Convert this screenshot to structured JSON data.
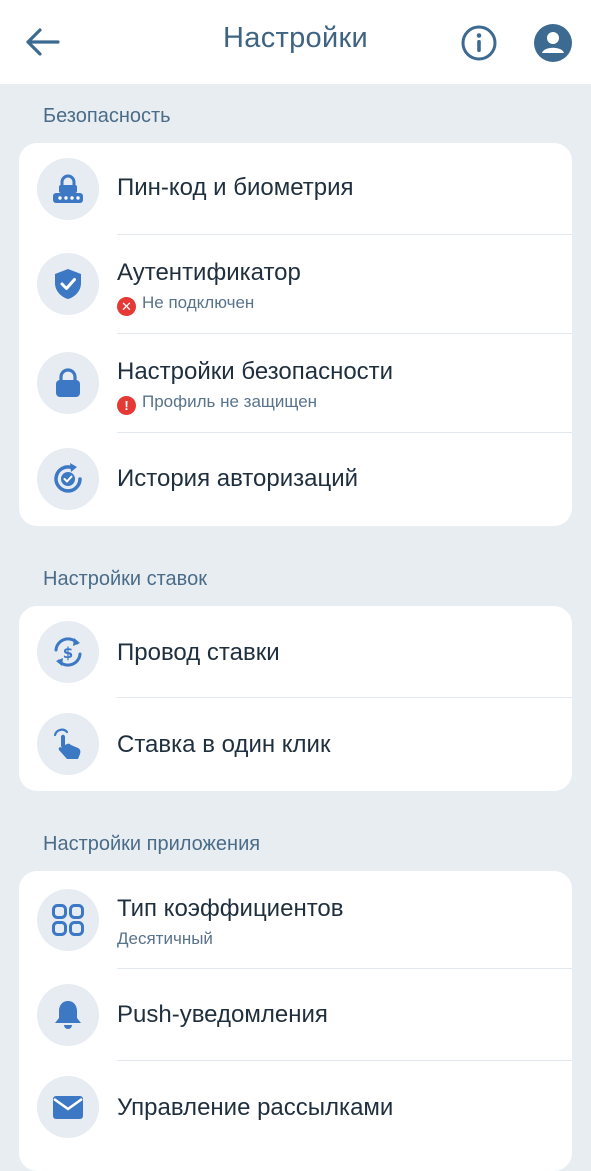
{
  "header": {
    "title": "Настройки"
  },
  "colors": {
    "accent": "#3d78c4",
    "icon_bg": "#e6ecf2",
    "error": "#e53935",
    "page_bg": "#e8edf2"
  },
  "security": {
    "title": "Безопасность",
    "items": [
      {
        "label": "Пин-код и биометрия",
        "icon": "keypad-lock-icon"
      },
      {
        "label": "Аутентификатор",
        "sub": "Не подключен",
        "sub_icon": "error-x-icon",
        "icon": "shield-check-icon"
      },
      {
        "label": "Настройки безопасности",
        "sub": "Профиль не защищен",
        "sub_icon": "warning-exclamation-icon",
        "icon": "lock-icon"
      },
      {
        "label": "История авторизаций",
        "icon": "history-check-icon"
      }
    ]
  },
  "bets": {
    "title": "Настройки ставок",
    "items": [
      {
        "label": "Провод ставки",
        "icon": "dollar-refresh-icon"
      },
      {
        "label": "Ставка в один клик",
        "icon": "tap-hand-icon"
      }
    ]
  },
  "app": {
    "title": "Настройки приложения",
    "items": [
      {
        "label": "Тип коэффициентов",
        "sub": "Десятичный",
        "icon": "grid-icon"
      },
      {
        "label": "Push-уведомления",
        "icon": "bell-icon"
      },
      {
        "label": "Управление рассылками",
        "icon": "mail-icon"
      }
    ]
  }
}
